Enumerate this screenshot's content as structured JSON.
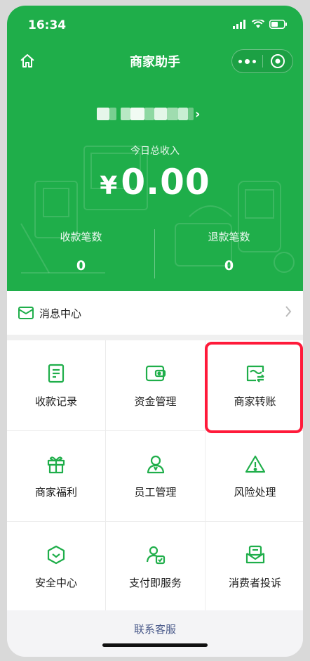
{
  "status_bar": {
    "time": "16:34"
  },
  "navbar": {
    "title": "商家助手"
  },
  "merchant": {
    "chevron": "›"
  },
  "summary": {
    "income_label": "今日总收入",
    "currency": "¥",
    "income_value": "0.00",
    "receipts_label": "收款笔数",
    "receipts_value": "0",
    "refunds_label": "退款笔数",
    "refunds_value": "0"
  },
  "message_center": {
    "label": "消息中心"
  },
  "grid": [
    {
      "label": "收款记录",
      "icon": "receipt-icon"
    },
    {
      "label": "资金管理",
      "icon": "wallet-icon"
    },
    {
      "label": "商家转账",
      "icon": "transfer-icon"
    },
    {
      "label": "商家福利",
      "icon": "gift-icon"
    },
    {
      "label": "员工管理",
      "icon": "staff-icon"
    },
    {
      "label": "风险处理",
      "icon": "warning-icon"
    },
    {
      "label": "安全中心",
      "icon": "shield-icon"
    },
    {
      "label": "支付即服务",
      "icon": "pay-service-icon"
    },
    {
      "label": "消费者投诉",
      "icon": "complaint-icon"
    }
  ],
  "footer": {
    "contact_label": "联系客服"
  },
  "colors": {
    "brand_green": "#1fae4a",
    "highlight_red": "#ff1a3a",
    "link_blue": "#4a5a8a"
  }
}
